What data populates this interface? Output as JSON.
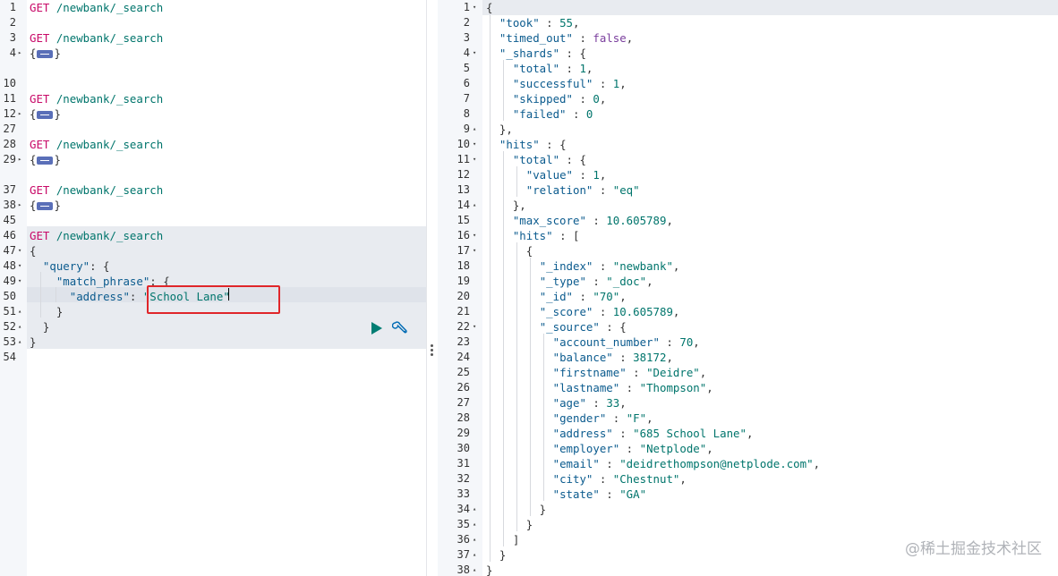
{
  "request_editor": {
    "lines": [
      {
        "no": "1",
        "parts": [
          [
            "verb",
            "GET "
          ],
          [
            "url",
            "/newbank/_search"
          ]
        ]
      },
      {
        "no": "2",
        "parts": []
      },
      {
        "no": "3",
        "parts": [
          [
            "verb",
            "GET "
          ],
          [
            "url",
            "/newbank/_search"
          ]
        ]
      },
      {
        "no": "4",
        "fold": "right",
        "parts": [
          [
            "punc",
            "{"
          ],
          [
            "marker",
            ""
          ],
          [
            "punc",
            "}"
          ]
        ]
      },
      {
        "no": "10",
        "parts": []
      },
      {
        "no": "11",
        "parts": [
          [
            "verb",
            "GET "
          ],
          [
            "url",
            "/newbank/_search"
          ]
        ]
      },
      {
        "no": "12",
        "fold": "right",
        "parts": [
          [
            "punc",
            "{"
          ],
          [
            "marker",
            ""
          ],
          [
            "punc",
            "}"
          ]
        ]
      },
      {
        "no": "27",
        "parts": []
      },
      {
        "no": "28",
        "parts": [
          [
            "verb",
            "GET "
          ],
          [
            "url",
            "/newbank/_search"
          ]
        ]
      },
      {
        "no": "29",
        "fold": "right",
        "parts": [
          [
            "punc",
            "{"
          ],
          [
            "marker",
            ""
          ],
          [
            "punc",
            "}"
          ]
        ]
      },
      {
        "no": "37",
        "parts": [
          [
            "verb",
            "GET "
          ],
          [
            "url",
            "/newbank/_search"
          ]
        ]
      },
      {
        "no": "38",
        "fold": "right",
        "parts": [
          [
            "punc",
            "{"
          ],
          [
            "marker",
            ""
          ],
          [
            "punc",
            "}"
          ]
        ]
      },
      {
        "no": "45",
        "parts": []
      },
      {
        "no": "46",
        "parts": [
          [
            "verb",
            "GET "
          ],
          [
            "url",
            "/newbank/_search"
          ]
        ]
      },
      {
        "no": "47",
        "fold": "down",
        "parts": [
          [
            "punc",
            "{"
          ]
        ]
      },
      {
        "no": "48",
        "fold": "down",
        "parts": [
          [
            "punc",
            "  "
          ],
          [
            "key",
            "\"query\""
          ],
          [
            "punc",
            ": {"
          ]
        ]
      },
      {
        "no": "49",
        "fold": "down",
        "parts": [
          [
            "punc",
            "    "
          ],
          [
            "key",
            "\"match_phrase\""
          ],
          [
            "punc",
            ": {"
          ]
        ]
      },
      {
        "no": "50",
        "parts": [
          [
            "punc",
            "      "
          ],
          [
            "key",
            "\"address\""
          ],
          [
            "punc",
            ": "
          ],
          [
            "str",
            "\"School Lane\""
          ]
        ]
      },
      {
        "no": "51",
        "fold": "up",
        "parts": [
          [
            "punc",
            "    }"
          ]
        ]
      },
      {
        "no": "52",
        "fold": "up",
        "parts": [
          [
            "punc",
            "  }"
          ]
        ]
      },
      {
        "no": "53",
        "fold": "up",
        "parts": [
          [
            "punc",
            "}"
          ]
        ]
      },
      {
        "no": "54",
        "parts": []
      }
    ]
  },
  "response_viewer": {
    "lines": [
      {
        "no": "1",
        "fold": "down",
        "parts": [
          [
            "punc",
            "{"
          ]
        ]
      },
      {
        "no": "2",
        "parts": [
          [
            "punc",
            "  "
          ],
          [
            "key",
            "\"took\""
          ],
          [
            "punc",
            " : "
          ],
          [
            "num",
            "55"
          ],
          [
            "punc",
            ","
          ]
        ]
      },
      {
        "no": "3",
        "parts": [
          [
            "punc",
            "  "
          ],
          [
            "key",
            "\"timed_out\""
          ],
          [
            "punc",
            " : "
          ],
          [
            "kw",
            "false"
          ],
          [
            "punc",
            ","
          ]
        ]
      },
      {
        "no": "4",
        "fold": "down",
        "parts": [
          [
            "punc",
            "  "
          ],
          [
            "key",
            "\"_shards\""
          ],
          [
            "punc",
            " : {"
          ]
        ]
      },
      {
        "no": "5",
        "parts": [
          [
            "punc",
            "    "
          ],
          [
            "key",
            "\"total\""
          ],
          [
            "punc",
            " : "
          ],
          [
            "num",
            "1"
          ],
          [
            "punc",
            ","
          ]
        ]
      },
      {
        "no": "6",
        "parts": [
          [
            "punc",
            "    "
          ],
          [
            "key",
            "\"successful\""
          ],
          [
            "punc",
            " : "
          ],
          [
            "num",
            "1"
          ],
          [
            "punc",
            ","
          ]
        ]
      },
      {
        "no": "7",
        "parts": [
          [
            "punc",
            "    "
          ],
          [
            "key",
            "\"skipped\""
          ],
          [
            "punc",
            " : "
          ],
          [
            "num",
            "0"
          ],
          [
            "punc",
            ","
          ]
        ]
      },
      {
        "no": "8",
        "parts": [
          [
            "punc",
            "    "
          ],
          [
            "key",
            "\"failed\""
          ],
          [
            "punc",
            " : "
          ],
          [
            "num",
            "0"
          ]
        ]
      },
      {
        "no": "9",
        "fold": "up",
        "parts": [
          [
            "punc",
            "  },"
          ]
        ]
      },
      {
        "no": "10",
        "fold": "down",
        "parts": [
          [
            "punc",
            "  "
          ],
          [
            "key",
            "\"hits\""
          ],
          [
            "punc",
            " : {"
          ]
        ]
      },
      {
        "no": "11",
        "fold": "down",
        "parts": [
          [
            "punc",
            "    "
          ],
          [
            "key",
            "\"total\""
          ],
          [
            "punc",
            " : {"
          ]
        ]
      },
      {
        "no": "12",
        "parts": [
          [
            "punc",
            "      "
          ],
          [
            "key",
            "\"value\""
          ],
          [
            "punc",
            " : "
          ],
          [
            "num",
            "1"
          ],
          [
            "punc",
            ","
          ]
        ]
      },
      {
        "no": "13",
        "parts": [
          [
            "punc",
            "      "
          ],
          [
            "key",
            "\"relation\""
          ],
          [
            "punc",
            " : "
          ],
          [
            "str",
            "\"eq\""
          ]
        ]
      },
      {
        "no": "14",
        "fold": "up",
        "parts": [
          [
            "punc",
            "    },"
          ]
        ]
      },
      {
        "no": "15",
        "parts": [
          [
            "punc",
            "    "
          ],
          [
            "key",
            "\"max_score\""
          ],
          [
            "punc",
            " : "
          ],
          [
            "num",
            "10.605789"
          ],
          [
            "punc",
            ","
          ]
        ]
      },
      {
        "no": "16",
        "fold": "down",
        "parts": [
          [
            "punc",
            "    "
          ],
          [
            "key",
            "\"hits\""
          ],
          [
            "punc",
            " : ["
          ]
        ]
      },
      {
        "no": "17",
        "fold": "down",
        "parts": [
          [
            "punc",
            "      {"
          ]
        ]
      },
      {
        "no": "18",
        "parts": [
          [
            "punc",
            "        "
          ],
          [
            "key",
            "\"_index\""
          ],
          [
            "punc",
            " : "
          ],
          [
            "str",
            "\"newbank\""
          ],
          [
            "punc",
            ","
          ]
        ]
      },
      {
        "no": "19",
        "parts": [
          [
            "punc",
            "        "
          ],
          [
            "key",
            "\"_type\""
          ],
          [
            "punc",
            " : "
          ],
          [
            "str",
            "\"_doc\""
          ],
          [
            "punc",
            ","
          ]
        ]
      },
      {
        "no": "20",
        "parts": [
          [
            "punc",
            "        "
          ],
          [
            "key",
            "\"_id\""
          ],
          [
            "punc",
            " : "
          ],
          [
            "str",
            "\"70\""
          ],
          [
            "punc",
            ","
          ]
        ]
      },
      {
        "no": "21",
        "parts": [
          [
            "punc",
            "        "
          ],
          [
            "key",
            "\"_score\""
          ],
          [
            "punc",
            " : "
          ],
          [
            "num",
            "10.605789"
          ],
          [
            "punc",
            ","
          ]
        ]
      },
      {
        "no": "22",
        "fold": "down",
        "parts": [
          [
            "punc",
            "        "
          ],
          [
            "key",
            "\"_source\""
          ],
          [
            "punc",
            " : {"
          ]
        ]
      },
      {
        "no": "23",
        "parts": [
          [
            "punc",
            "          "
          ],
          [
            "key",
            "\"account_number\""
          ],
          [
            "punc",
            " : "
          ],
          [
            "num",
            "70"
          ],
          [
            "punc",
            ","
          ]
        ]
      },
      {
        "no": "24",
        "parts": [
          [
            "punc",
            "          "
          ],
          [
            "key",
            "\"balance\""
          ],
          [
            "punc",
            " : "
          ],
          [
            "num",
            "38172"
          ],
          [
            "punc",
            ","
          ]
        ]
      },
      {
        "no": "25",
        "parts": [
          [
            "punc",
            "          "
          ],
          [
            "key",
            "\"firstname\""
          ],
          [
            "punc",
            " : "
          ],
          [
            "str",
            "\"Deidre\""
          ],
          [
            "punc",
            ","
          ]
        ]
      },
      {
        "no": "26",
        "parts": [
          [
            "punc",
            "          "
          ],
          [
            "key",
            "\"lastname\""
          ],
          [
            "punc",
            " : "
          ],
          [
            "str",
            "\"Thompson\""
          ],
          [
            "punc",
            ","
          ]
        ]
      },
      {
        "no": "27",
        "parts": [
          [
            "punc",
            "          "
          ],
          [
            "key",
            "\"age\""
          ],
          [
            "punc",
            " : "
          ],
          [
            "num",
            "33"
          ],
          [
            "punc",
            ","
          ]
        ]
      },
      {
        "no": "28",
        "parts": [
          [
            "punc",
            "          "
          ],
          [
            "key",
            "\"gender\""
          ],
          [
            "punc",
            " : "
          ],
          [
            "str",
            "\"F\""
          ],
          [
            "punc",
            ","
          ]
        ]
      },
      {
        "no": "29",
        "parts": [
          [
            "punc",
            "          "
          ],
          [
            "key",
            "\"address\""
          ],
          [
            "punc",
            " : "
          ],
          [
            "str",
            "\"685 School Lane\""
          ],
          [
            "punc",
            ","
          ]
        ]
      },
      {
        "no": "30",
        "parts": [
          [
            "punc",
            "          "
          ],
          [
            "key",
            "\"employer\""
          ],
          [
            "punc",
            " : "
          ],
          [
            "str",
            "\"Netplode\""
          ],
          [
            "punc",
            ","
          ]
        ]
      },
      {
        "no": "31",
        "parts": [
          [
            "punc",
            "          "
          ],
          [
            "key",
            "\"email\""
          ],
          [
            "punc",
            " : "
          ],
          [
            "str",
            "\"deidrethompson@netplode.com\""
          ],
          [
            "punc",
            ","
          ]
        ]
      },
      {
        "no": "32",
        "parts": [
          [
            "punc",
            "          "
          ],
          [
            "key",
            "\"city\""
          ],
          [
            "punc",
            " : "
          ],
          [
            "str",
            "\"Chestnut\""
          ],
          [
            "punc",
            ","
          ]
        ]
      },
      {
        "no": "33",
        "parts": [
          [
            "punc",
            "          "
          ],
          [
            "key",
            "\"state\""
          ],
          [
            "punc",
            " : "
          ],
          [
            "str",
            "\"GA\""
          ]
        ]
      },
      {
        "no": "34",
        "fold": "up",
        "parts": [
          [
            "punc",
            "        }"
          ]
        ]
      },
      {
        "no": "35",
        "fold": "up",
        "parts": [
          [
            "punc",
            "      }"
          ]
        ]
      },
      {
        "no": "36",
        "fold": "up",
        "parts": [
          [
            "punc",
            "    ]"
          ]
        ]
      },
      {
        "no": "37",
        "fold": "up",
        "parts": [
          [
            "punc",
            "  }"
          ]
        ]
      },
      {
        "no": "38",
        "fold": "up",
        "parts": [
          [
            "punc",
            "}"
          ]
        ]
      }
    ]
  },
  "actions": {
    "run_icon": "play-icon",
    "settings_icon": "wrench-icon",
    "run_color": "#017d73",
    "settings_color": "#006bb4"
  },
  "highlight_color": "#e0262a",
  "watermark": "@稀土掘金技术社区"
}
